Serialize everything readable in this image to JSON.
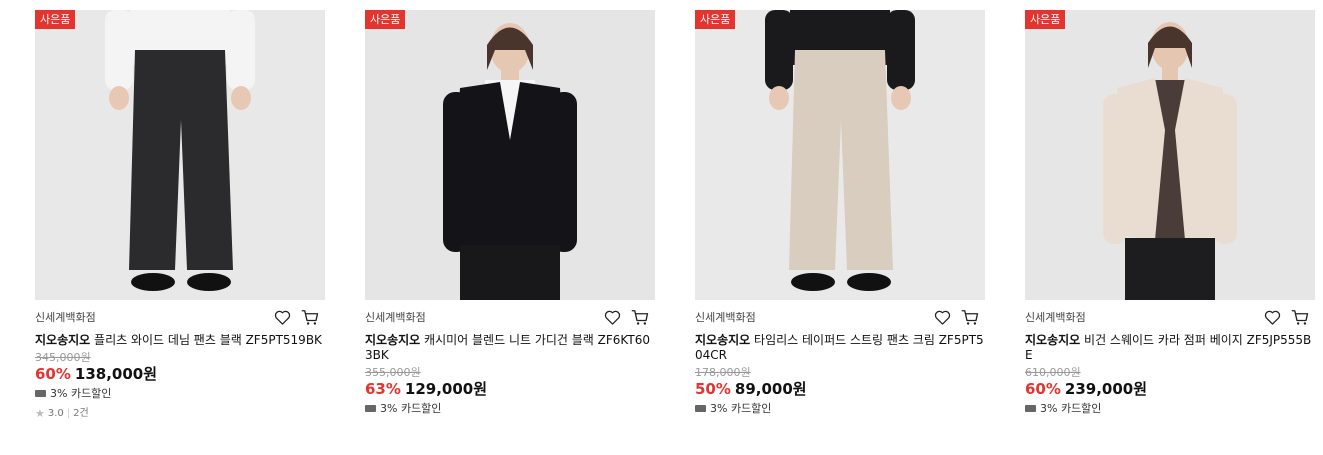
{
  "products": [
    {
      "badge": "사은품",
      "seller": "신세계백화점",
      "brand": "지오송지오",
      "name": "플리츠 와이드 데님 팬츠 블랙 ZF5PT519BK",
      "original_price": "345,000원",
      "discount": "60%",
      "price": "138,000원",
      "card_discount": "3% 카드할인",
      "rating": "3.0",
      "reviews": "2건",
      "garment": "pants",
      "colors": {
        "bg": "#e8e8e8",
        "top": "#f4f4f4",
        "bottom": "#2b2b2d",
        "skin": "#e7c8b4"
      }
    },
    {
      "badge": "사은품",
      "seller": "신세계백화점",
      "brand": "지오송지오",
      "name": "캐시미어 블렌드 니트 가디건 블랙 ZF6KT603BK",
      "original_price": "355,000원",
      "discount": "63%",
      "price": "129,000원",
      "card_discount": "3% 카드할인",
      "garment": "cardigan",
      "colors": {
        "bg": "#e5e5e5",
        "top": "#141418",
        "bottom": "#18181b",
        "skin": "#e6c7b2"
      }
    },
    {
      "badge": "사은품",
      "seller": "신세계백화점",
      "brand": "지오송지오",
      "name": "타임리스 테이퍼드 스트링 팬츠 크림 ZF5PT504CR",
      "original_price": "178,000원",
      "discount": "50%",
      "price": "89,000원",
      "card_discount": "3% 카드할인",
      "garment": "pants",
      "colors": {
        "bg": "#e9e9e9",
        "top": "#1a1a1c",
        "bottom": "#d8cdbf",
        "skin": "#e7c8b4"
      }
    },
    {
      "badge": "사은품",
      "seller": "신세계백화점",
      "brand": "지오송지오",
      "name": "비건 스웨이드 카라 점퍼 베이지 ZF5JP555BE",
      "original_price": "610,000원",
      "discount": "60%",
      "price": "239,000원",
      "card_discount": "3% 카드할인",
      "garment": "jacket",
      "colors": {
        "bg": "#e6e6e6",
        "top": "#e8ddd0",
        "bottom": "#1d1d20",
        "skin": "#e5c6b1",
        "inner": "#4a3c38"
      }
    }
  ]
}
